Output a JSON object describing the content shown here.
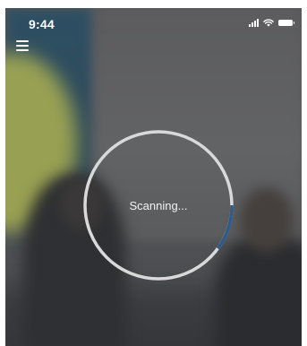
{
  "status_bar": {
    "time": "9:44",
    "icons": [
      "cellular-signal-icon",
      "wifi-icon",
      "battery-icon"
    ]
  },
  "menu": {
    "icon": "hamburger-menu-icon"
  },
  "scanner": {
    "label": "Scanning...",
    "progress": 0.2,
    "ring_color": "#d9d9d9",
    "progress_color": "#2f5a8c"
  }
}
